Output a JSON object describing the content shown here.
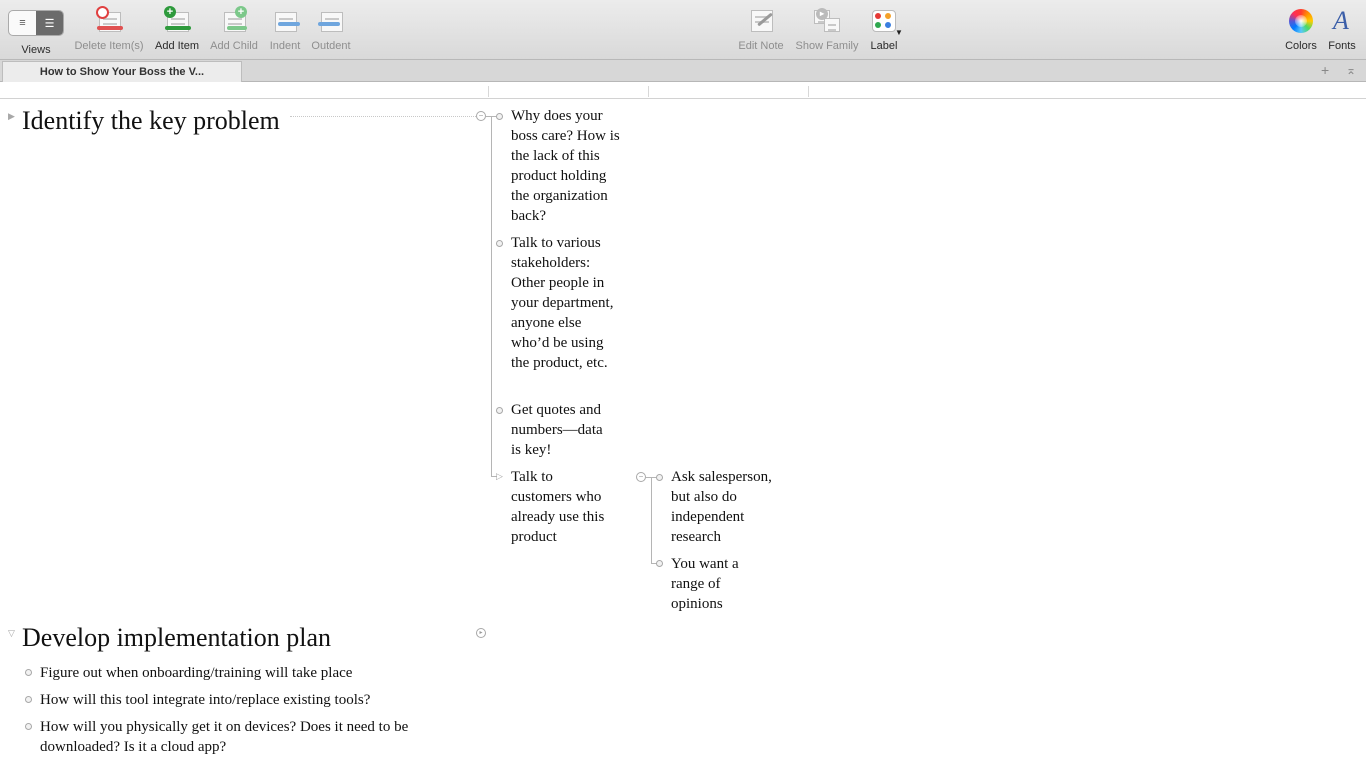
{
  "toolbar": {
    "views": "Views",
    "delete": "Delete Item(s)",
    "add_item": "Add Item",
    "add_child": "Add Child",
    "indent": "Indent",
    "outdent": "Outdent",
    "edit_note": "Edit Note",
    "show_family": "Show Family",
    "label": "Label",
    "colors": "Colors",
    "fonts": "Fonts",
    "fonts_glyph": "A"
  },
  "tab": {
    "title": "How to Show Your Boss the V...",
    "add_glyph": "+",
    "pin_glyph": "⌅"
  },
  "outline": {
    "topic1": {
      "title": "Identify the key problem",
      "children": [
        "Why does your boss care? How is the lack of this product holding the organization back?",
        "Talk to various stakeholders: Other people in your department, anyone else who’d be using the product, etc.",
        "Get quotes and numbers—data is key!",
        "Talk to customers who already use this product"
      ],
      "grandchildren": [
        "Ask salesperson, but also do independent research",
        "You want a range of opinions"
      ]
    },
    "topic2": {
      "title": "Develop implementation plan",
      "items": [
        "Figure out when onboarding/training will take place",
        "How will this tool integrate into/replace existing tools?",
        "How will you physically get it on devices? Does it need to be downloaded? Is it a cloud app?"
      ]
    }
  }
}
